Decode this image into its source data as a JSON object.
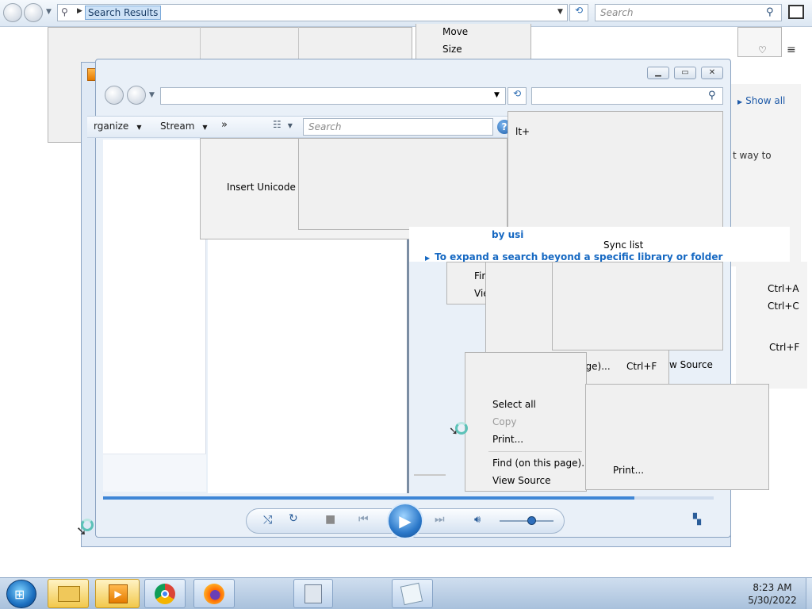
{
  "explorer": {
    "address_value": "Search Results",
    "search_placeholder": "Search"
  },
  "context_menu_top": {
    "move": "Move",
    "size": "Size"
  },
  "background_texts": {
    "show_all": "Show all",
    "way_to": "t way to",
    "alt_plus": "lt+",
    "insert_unicode": "Insert Unicode co",
    "by_us": "by usi",
    "sync_list": "Sync list",
    "expand_search": "To expand a search beyond a specific library or folder",
    "fin": "Fin",
    "vie": "Vie",
    "view_source_partial": "w Source"
  },
  "browser_menu": {
    "ctrl_a": "Ctrl+A",
    "ctrl_c": "Ctrl+C",
    "ctrl_f_right": "Ctrl+F",
    "find_on_page": "Find (on this page)...",
    "find_ctrl_f": "Ctrl+F"
  },
  "context_menu_lower": {
    "select_all": "Select all",
    "copy": "Copy",
    "print": "Print...",
    "find_on_page": "Find (on this page)...",
    "view_source": "View Source"
  },
  "print_menu": {
    "print": "Print..."
  },
  "wmp": {
    "toolbar": {
      "organize": "rganize",
      "stream": "Stream",
      "more": "»",
      "search_placeholder": "Search"
    },
    "volume_level": 0.6,
    "seek_fraction": 0.87
  },
  "taskbar": {
    "time": "8:23 AM",
    "date": "5/30/2022"
  }
}
